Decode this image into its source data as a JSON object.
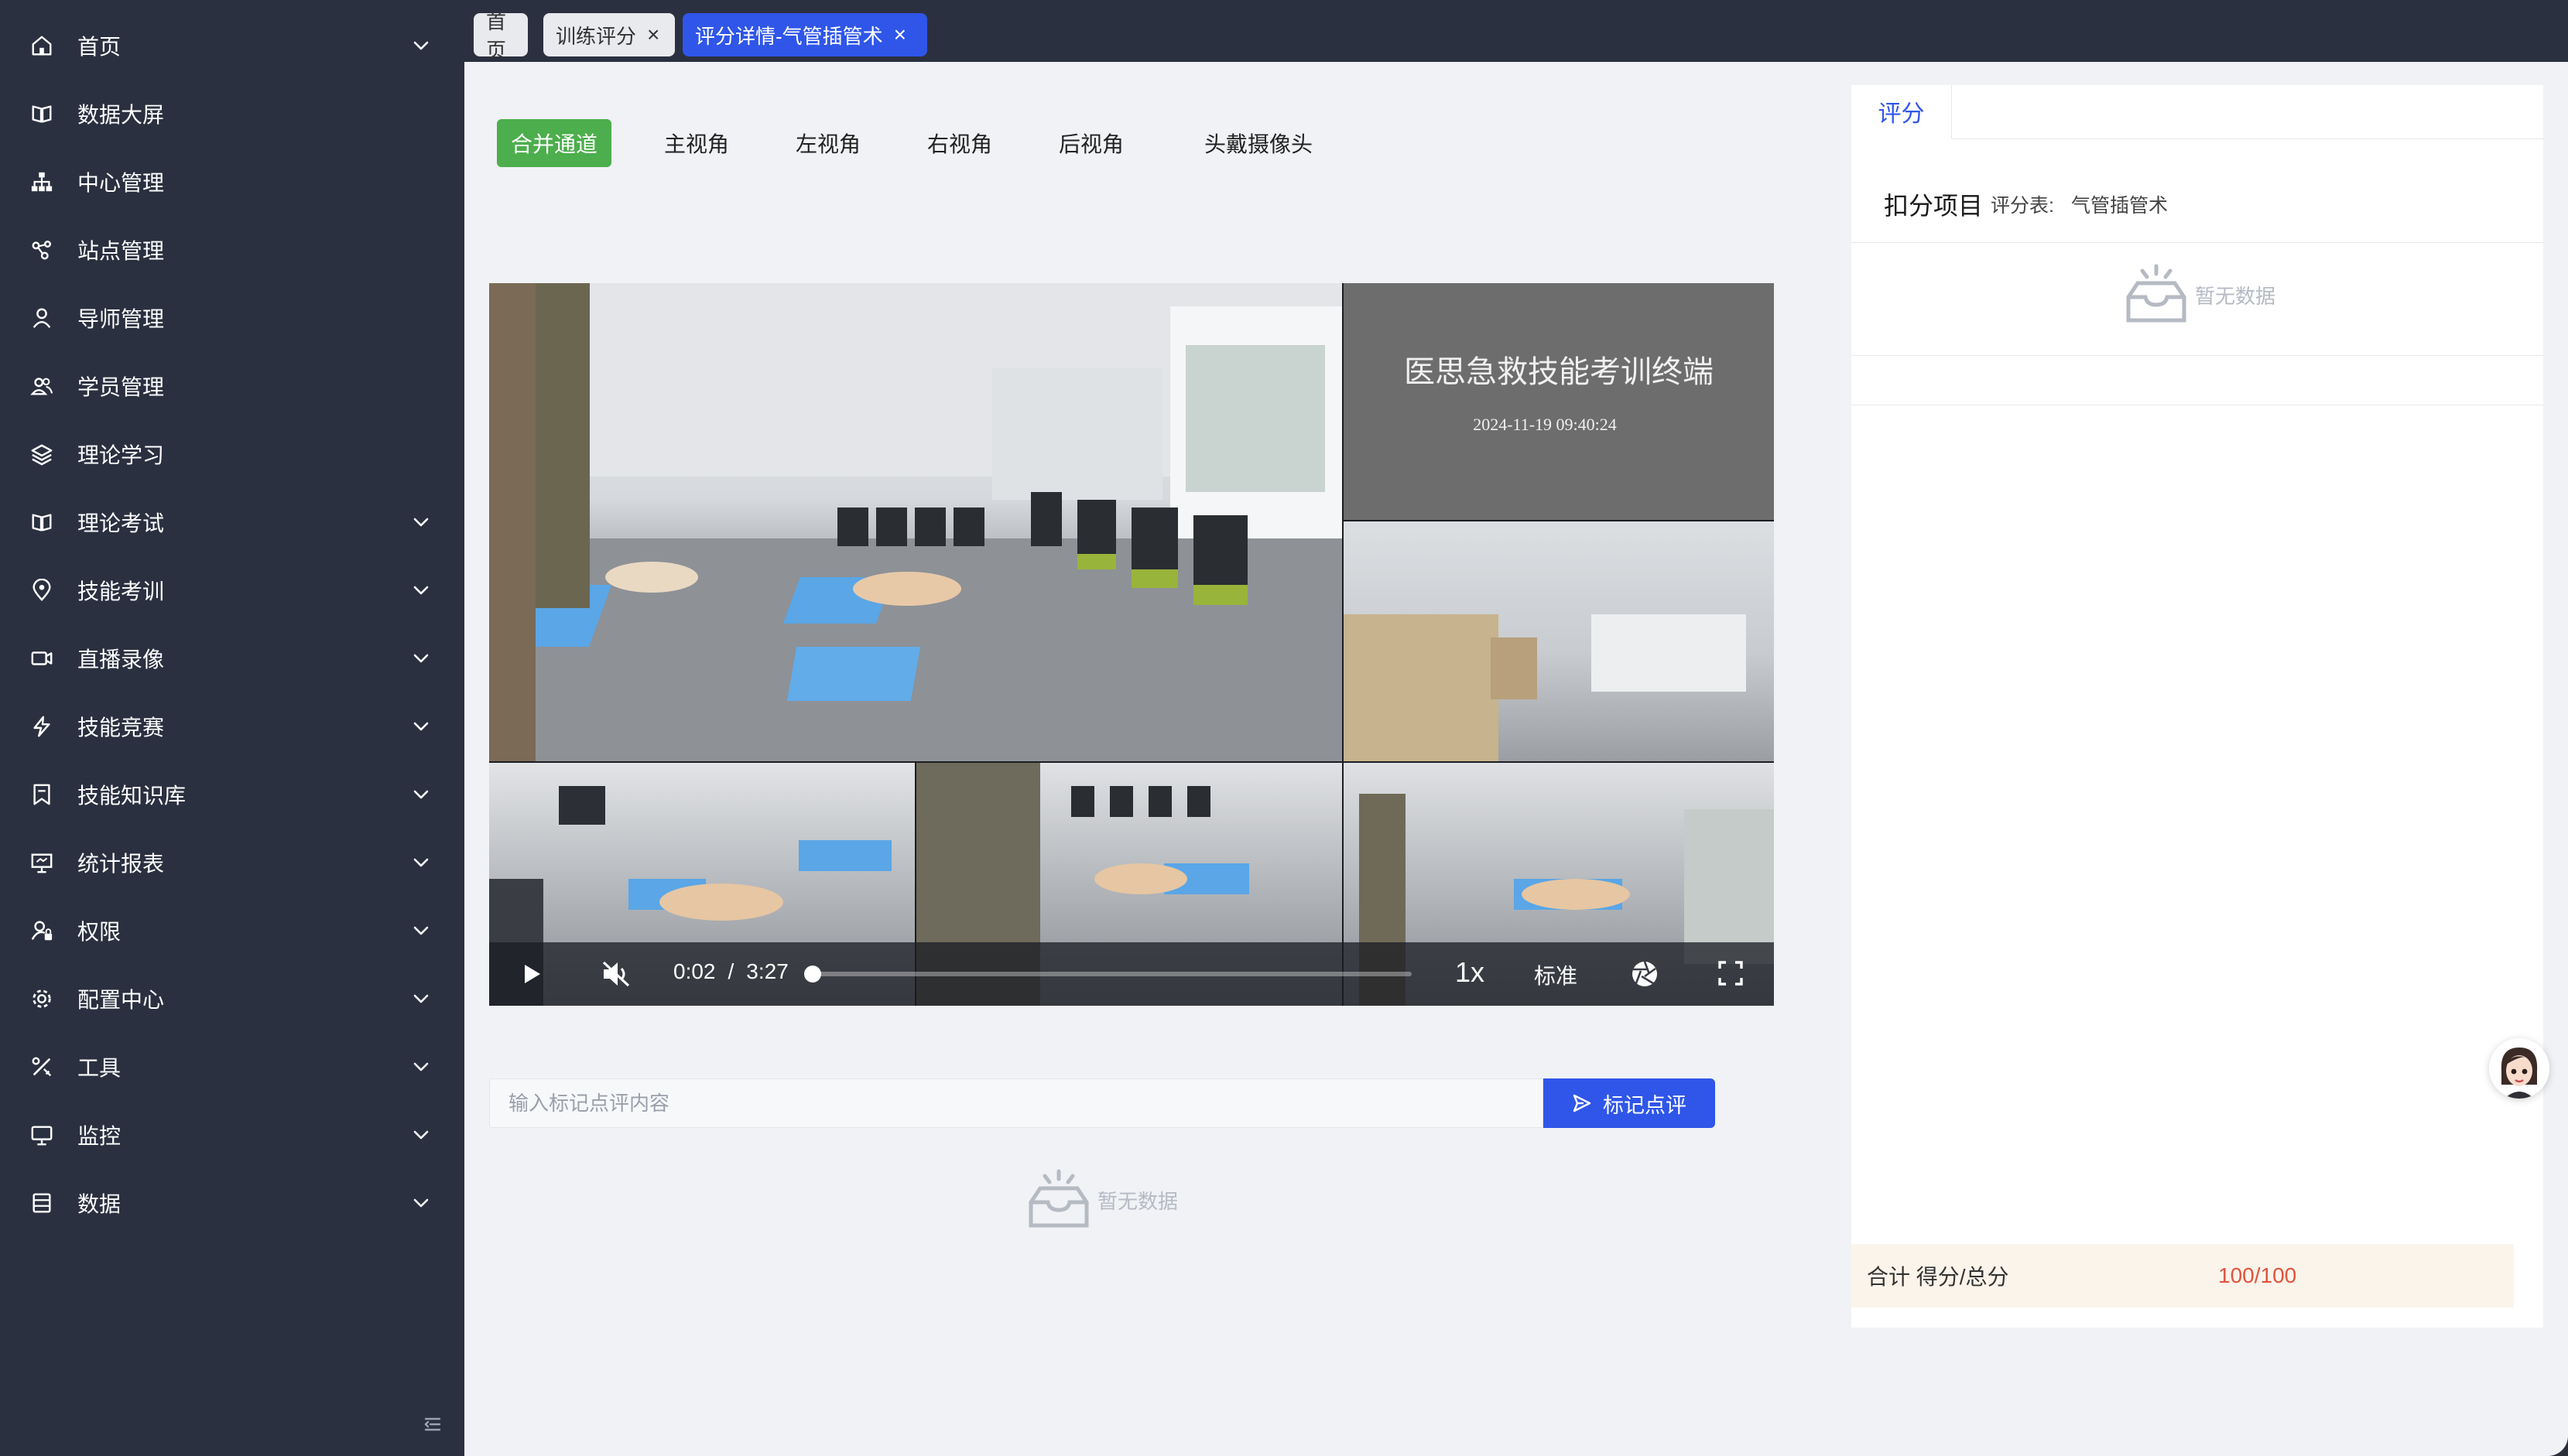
{
  "sidebar": {
    "items": [
      {
        "label": "首页",
        "icon": "home-icon",
        "expandable": true
      },
      {
        "label": "数据大屏",
        "icon": "book-icon",
        "expandable": false
      },
      {
        "label": "中心管理",
        "icon": "org-tree-icon",
        "expandable": false
      },
      {
        "label": "站点管理",
        "icon": "share-nodes-icon",
        "expandable": false
      },
      {
        "label": "导师管理",
        "icon": "user-icon",
        "expandable": false
      },
      {
        "label": "学员管理",
        "icon": "users-icon",
        "expandable": false
      },
      {
        "label": "理论学习",
        "icon": "layers-icon",
        "expandable": false
      },
      {
        "label": "理论考试",
        "icon": "book-icon",
        "expandable": true
      },
      {
        "label": "技能考训",
        "icon": "location-pin-icon",
        "expandable": true
      },
      {
        "label": "直播录像",
        "icon": "video-camera-icon",
        "expandable": true
      },
      {
        "label": "技能竞赛",
        "icon": "lightning-icon",
        "expandable": true
      },
      {
        "label": "技能知识库",
        "icon": "bookmark-icon",
        "expandable": true
      },
      {
        "label": "统计报表",
        "icon": "presentation-icon",
        "expandable": true
      },
      {
        "label": "权限",
        "icon": "user-lock-icon",
        "expandable": true
      },
      {
        "label": "配置中心",
        "icon": "gear-icon",
        "expandable": true
      },
      {
        "label": "工具",
        "icon": "tools-icon",
        "expandable": true
      },
      {
        "label": "监控",
        "icon": "monitor-icon",
        "expandable": true
      },
      {
        "label": "数据",
        "icon": "database-icon",
        "expandable": true
      }
    ]
  },
  "tabs": [
    {
      "label": "首页",
      "closable": false,
      "active": false
    },
    {
      "label": "训练评分",
      "closable": true,
      "active": false
    },
    {
      "label": "评分详情-气管插管术",
      "closable": true,
      "active": true
    }
  ],
  "view_tabs": [
    {
      "label": "合并通道",
      "active": true
    },
    {
      "label": "主视角",
      "active": false
    },
    {
      "label": "左视角",
      "active": false
    },
    {
      "label": "右视角",
      "active": false
    },
    {
      "label": "后视角",
      "active": false
    },
    {
      "label": "头戴摄像头",
      "active": false
    }
  ],
  "video": {
    "overlay_title": "医思急救技能考训终端",
    "overlay_time": "2024-11-19 09:40:24",
    "current_time": "0:02",
    "separator": "/",
    "duration": "3:27",
    "progress_fraction": 0.005,
    "speed": "1x",
    "quality": "标准"
  },
  "note": {
    "placeholder": "输入标记点评内容",
    "button_label": "标记点评",
    "empty_text": "暂无数据"
  },
  "score_panel": {
    "tab_label": "评分",
    "section_title": "扣分项目",
    "sheet_prefix": "评分表:",
    "sheet_name": "气管插管术",
    "empty_text": "暂无数据",
    "total_label": "合计 得分/总分",
    "total_value": "100/100",
    "accent_color": "#2f56e8",
    "total_color": "#e0533d"
  }
}
